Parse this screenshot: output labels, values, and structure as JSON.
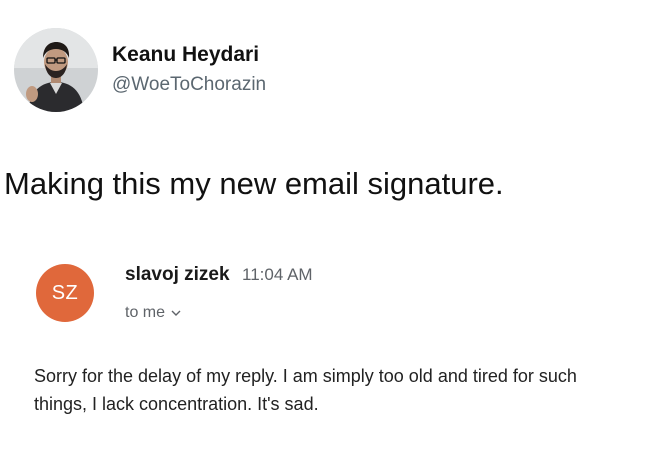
{
  "tweet": {
    "author_name": "Keanu Heydari",
    "author_handle": "@WoeToChorazin",
    "text": "Making this my new email signature."
  },
  "email": {
    "sender_initials": "SZ",
    "sender_name": "slavoj zizek",
    "sent_time": "11:04 AM",
    "recipient_label": "to me",
    "body": "Sorry for the delay of my reply. I am simply too old and tired for such things, I lack concentration. It's sad."
  },
  "colors": {
    "sender_avatar_bg": "#e0683b",
    "handle_gray": "#5b6770",
    "meta_gray": "#5f6368"
  },
  "icons": {
    "recipient_dropdown": "chevron-down-icon"
  }
}
